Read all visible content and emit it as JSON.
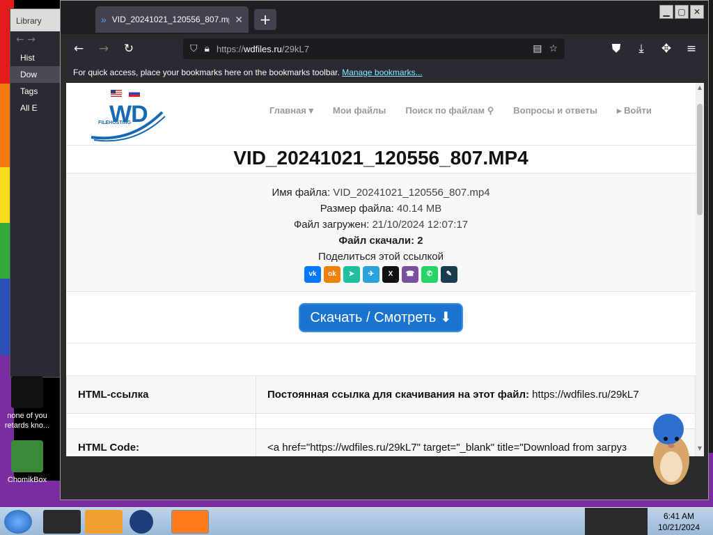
{
  "library": {
    "title": "Library",
    "items": [
      "Hist",
      "Dow",
      "Tags",
      "All E"
    ]
  },
  "desktop_icons": [
    {
      "label": "none of you retards kno..."
    },
    {
      "label": "ChomikBox"
    }
  ],
  "browser": {
    "tab_title": "VID_20241021_120556_807.mp4",
    "url_prefix": "https://",
    "url_domain": "wdfiles.ru",
    "url_path": "/29kL7",
    "bookmarks_text": "For quick access, place your bookmarks here on the bookmarks toolbar.",
    "bookmarks_link": "Manage bookmarks..."
  },
  "site": {
    "logo_text": "WD",
    "logo_sub": "FILEHOSTING",
    "nav": [
      "Главная ▾",
      "Мои файлы",
      "Поиск по файлам",
      "Вопросы и ответы",
      "▸ Войти"
    ],
    "file_title": "VID_20241021_120556_807.MP4",
    "info": {
      "name_label": "Имя файла:",
      "name_value": "VID_20241021_120556_807.mp4",
      "size_label": "Размер файла:",
      "size_value": "40.14 MB",
      "uploaded_label": "Файл загружен:",
      "uploaded_value": "21/10/2024 12:07:17",
      "downloads_label": "Файл скачали:",
      "downloads_value": "2",
      "share_label": "Поделиться этой ссылкой"
    },
    "share_icons": [
      {
        "name": "vk-icon",
        "glyph": "vk",
        "color": "#0077ff"
      },
      {
        "name": "odnoklassniki-icon",
        "glyph": "ok",
        "color": "#ee8208"
      },
      {
        "name": "sharer-icon",
        "glyph": "➤",
        "color": "#1fbfa0"
      },
      {
        "name": "telegram-icon",
        "glyph": "✈",
        "color": "#2aa3dc"
      },
      {
        "name": "x-icon",
        "glyph": "X",
        "color": "#111111"
      },
      {
        "name": "viber-icon",
        "glyph": "☎",
        "color": "#7b519d"
      },
      {
        "name": "whatsapp-icon",
        "glyph": "✆",
        "color": "#25d366"
      },
      {
        "name": "livejournal-icon",
        "glyph": "✎",
        "color": "#1b3b4f"
      }
    ],
    "download_button": "Скачать / Смотреть ⬇",
    "links": [
      {
        "label": "HTML-ссылка",
        "value_bold": "Постоянная ссылка для скачивания на этот файл:",
        "value": " https://wdfiles.ru/29kL7"
      },
      {
        "label": "HTML Code:",
        "value_bold": "",
        "value": "<a href=\"https://wdfiles.ru/29kL7\" target=\"_blank\" title=\"Download from загруз"
      }
    ]
  },
  "taskbar": {
    "time": "6:41 AM",
    "date": "10/21/2024"
  }
}
